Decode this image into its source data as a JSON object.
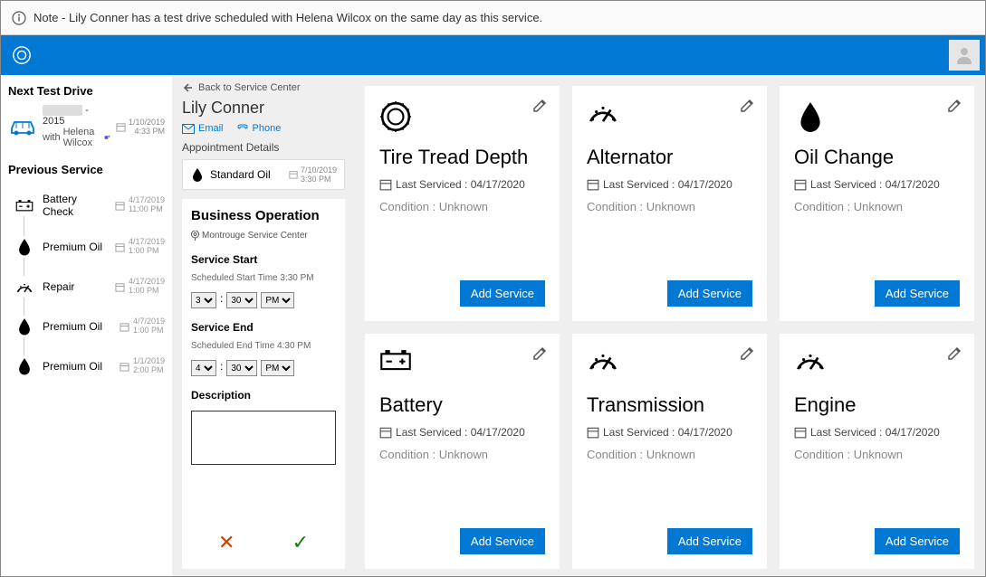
{
  "note": "Note - Lily Conner has a test drive scheduled with Helena Wilcox on the same day as this service.",
  "sidebar": {
    "next_heading": "Next Test Drive",
    "next_item": {
      "vehicle": "- 2015",
      "with_prefix": "with",
      "advisor": "Helena Wilcox",
      "date": "1/10/2019",
      "time": "4:33 PM"
    },
    "prev_heading": "Previous Service",
    "prev_items": [
      {
        "label": "Battery Check",
        "date": "4/17/2019",
        "time": "11:00 PM",
        "icon": "battery"
      },
      {
        "label": "Premium Oil",
        "date": "4/17/2019",
        "time": "1:00 PM",
        "icon": "oil"
      },
      {
        "label": "Repair",
        "date": "4/17/2019",
        "time": "1:00 PM",
        "icon": "gauge"
      },
      {
        "label": "Premium Oil",
        "date": "4/7/2019",
        "time": "1:00 PM",
        "icon": "oil"
      },
      {
        "label": "Premium Oil",
        "date": "1/1/2019",
        "time": "2:00 PM",
        "icon": "oil"
      }
    ]
  },
  "mid": {
    "back": "Back to Service Center",
    "customer": "Lily Conner",
    "email": "Email",
    "phone": "Phone",
    "appt_label": "Appointment Details",
    "appt_name": "Standard Oil",
    "appt_date": "7/10/2019",
    "appt_time": "3:30 PM",
    "biz_heading": "Business Operation",
    "location": "Montrouge Service Center",
    "start_label": "Service Start",
    "start_sched": "Scheduled Start Time 3:30 PM",
    "end_label": "Service End",
    "end_sched": "Scheduled End Time 4:30 PM",
    "desc_label": "Description",
    "time_opts": {
      "h": "3",
      "m": "30",
      "ap": "PM"
    },
    "time_opts_end": {
      "h": "4",
      "m": "30",
      "ap": "PM"
    }
  },
  "cards": [
    {
      "title": "Tire Tread Depth",
      "last": "Last Serviced : 04/17/2020",
      "cond": "Condition : Unknown",
      "btn": "Add Service",
      "icon": "tire"
    },
    {
      "title": "Alternator",
      "last": "Last Serviced : 04/17/2020",
      "cond": "Condition : Unknown",
      "btn": "Add Service",
      "icon": "gauge"
    },
    {
      "title": "Oil Change",
      "last": "Last Serviced : 04/17/2020",
      "cond": "Condition : Unknown",
      "btn": "Add Service",
      "icon": "oil"
    },
    {
      "title": "Battery",
      "last": "Last Serviced : 04/17/2020",
      "cond": "Condition : Unknown",
      "btn": "Add Service",
      "icon": "battery"
    },
    {
      "title": "Transmission",
      "last": "Last Serviced : 04/17/2020",
      "cond": "Condition : Unknown",
      "btn": "Add Service",
      "icon": "gauge"
    },
    {
      "title": "Engine",
      "last": "Last Serviced : 04/17/2020",
      "cond": "Condition : Unknown",
      "btn": "Add Service",
      "icon": "gauge"
    }
  ]
}
